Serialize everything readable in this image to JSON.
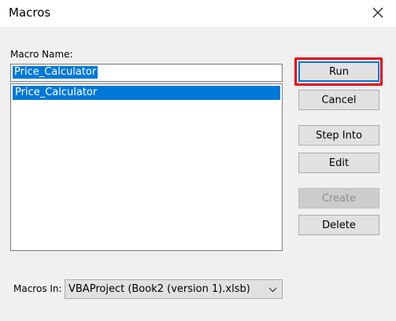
{
  "window": {
    "title": "Macros"
  },
  "form": {
    "macro_name_label": "Macro Name:",
    "macro_name_value": "Price_Calculator",
    "macros_in_label": "Macros In:",
    "macros_in_value": "VBAProject (Book2 (version 1).xlsb)"
  },
  "macro_list": {
    "items": [
      {
        "label": "Price_Calculator",
        "selected": true
      }
    ]
  },
  "buttons": {
    "run": "Run",
    "cancel": "Cancel",
    "step_into": "Step Into",
    "edit": "Edit",
    "create": "Create",
    "delete": "Delete"
  },
  "icons": {
    "close": "close-icon",
    "dropdown": "chevron-down-icon"
  },
  "colors": {
    "selection": "#0078d7",
    "highlight": "#e8000c"
  }
}
